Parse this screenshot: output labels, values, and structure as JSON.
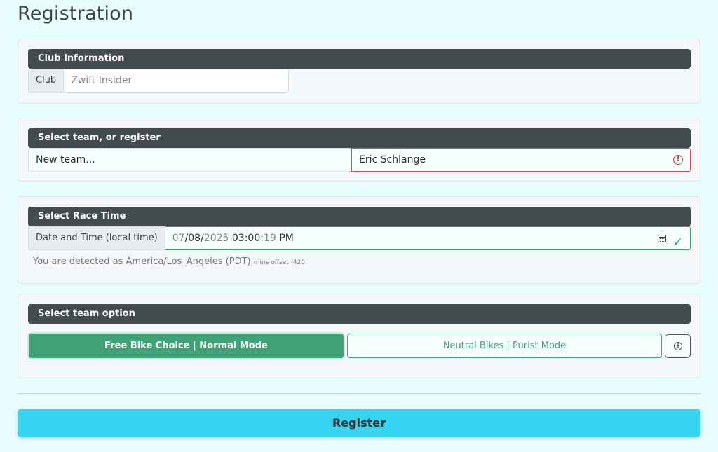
{
  "page": {
    "title": "Registration"
  },
  "club_card": {
    "header": "Club Information",
    "club_label": "Club",
    "club_placeholder": "Zwift Insider"
  },
  "team_card": {
    "header": "Select team, or register",
    "team_select_value": "New team...",
    "team_name_value": "Eric Schlange"
  },
  "race_time_card": {
    "header": "Select Race Time",
    "datetime_label": "Date and Time (local time)",
    "datetime": {
      "month": "07",
      "sep1": "/",
      "day": "08",
      "sep2": "/",
      "year": "2025",
      "hour": "03",
      "sep3": ":",
      "minute": "00",
      "sep4": ":",
      "second": "19",
      "ampm": "PM"
    },
    "timezone_text": "You are detected as America/Los_Angeles (PDT)",
    "offset_text": "mins offset -420"
  },
  "team_option_card": {
    "header": "Select team option",
    "option_free": "Free Bike Choice | Normal Mode",
    "option_neutral": "Neutral Bikes | Purist Mode",
    "info_symbol": "i"
  },
  "register_label": "Register",
  "colors": {
    "accent_green": "#41a177",
    "header_dark": "#434c4f",
    "register_cyan": "#36d4f0",
    "error_red": "#d9505d"
  },
  "icons": {
    "error": "exclamation-circle-icon",
    "calendar": "calendar-icon",
    "valid": "check-icon",
    "info": "info-circle-icon"
  }
}
